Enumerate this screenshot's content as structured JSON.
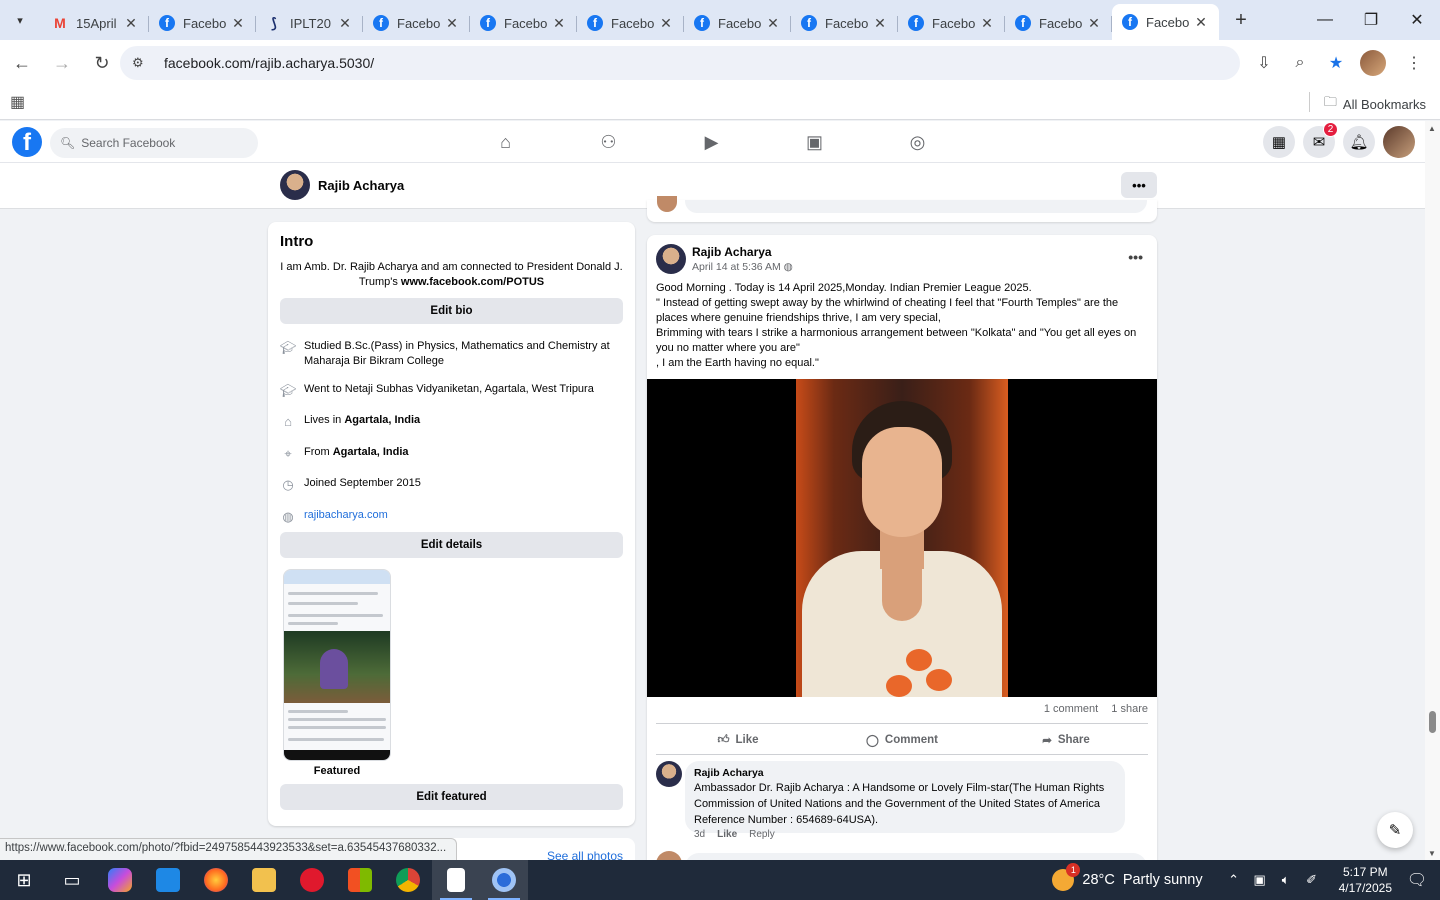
{
  "browser": {
    "tabs": [
      {
        "title": "15April",
        "favicon": "gmail-icon"
      },
      {
        "title": "Facebo",
        "favicon": "facebook-icon"
      },
      {
        "title": "IPLT20",
        "favicon": "ipl-icon"
      },
      {
        "title": "Facebo",
        "favicon": "facebook-icon"
      },
      {
        "title": "Facebo",
        "favicon": "facebook-icon"
      },
      {
        "title": "Facebo",
        "favicon": "facebook-icon"
      },
      {
        "title": "Facebo",
        "favicon": "facebook-icon"
      },
      {
        "title": "Facebo",
        "favicon": "facebook-icon"
      },
      {
        "title": "Facebo",
        "favicon": "facebook-icon"
      },
      {
        "title": "Facebo",
        "favicon": "facebook-icon"
      },
      {
        "title": "Facebo",
        "favicon": "facebook-icon",
        "active": true
      }
    ],
    "url": "facebook.com/rajib.acharya.5030/",
    "bookmarks_all": "All Bookmarks",
    "status_url": "https://www.facebook.com/photo/?fbid=2497585443923533&set=a.63545437680332..."
  },
  "facebook": {
    "search_placeholder": "Search Facebook",
    "messenger_badge": "2",
    "profile_name": "Rajib Acharya",
    "intro": {
      "heading": "Intro",
      "bio_text": "I am Amb. Dr. Rajib Acharya and am connected to President Donald J. Trump's ",
      "bio_link": "www.facebook.com/POTUS",
      "edit_bio": "Edit bio",
      "details": [
        {
          "icon": "graduation-cap-icon",
          "text": "Studied B.Sc.(Pass) in Physics, Mathematics and Chemistry at Maharaja Bir Bikram College"
        },
        {
          "icon": "graduation-cap-icon",
          "text": "Went to Netaji Subhas Vidyaniketan, Agartala, West Tripura"
        },
        {
          "icon": "home-icon",
          "prefix": "Lives in ",
          "bold": "Agartala, India"
        },
        {
          "icon": "location-pin-icon",
          "prefix": "From ",
          "bold": "Agartala, India"
        },
        {
          "icon": "clock-icon",
          "text": "Joined September 2015"
        },
        {
          "icon": "globe-icon",
          "link": "rajibacharya.com"
        }
      ],
      "edit_details": "Edit details",
      "featured_label": "Featured",
      "edit_featured": "Edit featured",
      "see_all_photos": "See all photos"
    },
    "post": {
      "author": "Rajib Acharya",
      "date": "April 14 at 5:36 AM",
      "text": "Good Morning . Today is 14 April 2025,Monday. Indian Premier League 2025.\n\" Instead of getting swept away by the whirlwind of cheating I feel that \"Fourth Temples\" are the places where genuine friendships thrive, I am very special,\nBrimming with tears I strike a harmonious arrangement between \"Kolkata\" and \"You get all eyes on you no matter where you are\"\n, I am the Earth having no equal.\"",
      "comments_count": "1 comment",
      "shares_count": "1 share",
      "like": "Like",
      "comment": "Comment",
      "share": "Share",
      "top_comment": {
        "author": "Rajib Acharya",
        "text": "Ambassador Dr. Rajib Acharya : A Handsome or Lovely Film-star(The Human Rights Commission of United Nations and the Government of the United States of America Reference Number : 654689-64USA).",
        "age": "3d",
        "like": "Like",
        "reply": "Reply"
      }
    }
  },
  "taskbar": {
    "weather_temp": "28°C",
    "weather_desc": "Partly sunny",
    "weather_badge": "1",
    "time": "5:17 PM",
    "date": "4/17/2025"
  },
  "colors": {
    "facebook_blue": "#1877f2",
    "link_blue": "#216fdb",
    "badge_red": "#e41e3f"
  }
}
